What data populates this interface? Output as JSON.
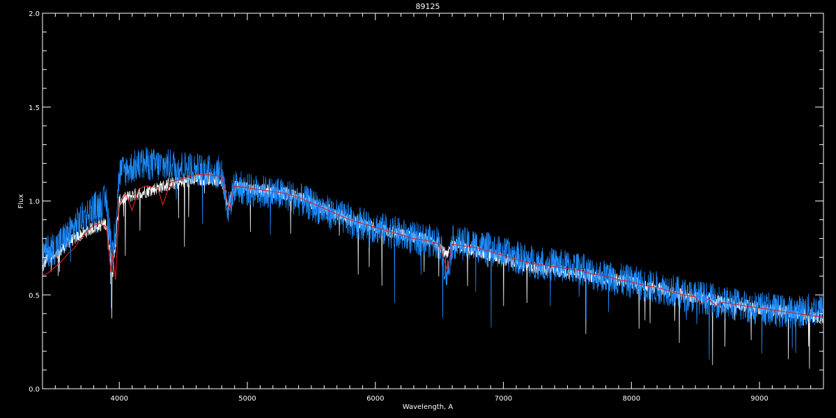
{
  "chart_data": {
    "type": "line",
    "title": "89125",
    "xlabel": "Wavelength, A",
    "ylabel": "Flux",
    "xlim": [
      3400,
      9500
    ],
    "ylim": [
      0.0,
      2.0
    ],
    "xticks": [
      4000,
      5000,
      6000,
      7000,
      8000,
      9000
    ],
    "xtick_labels": [
      "4000",
      "5000",
      "6000",
      "7000",
      "8000",
      "9000"
    ],
    "yticks": [
      0.0,
      0.5,
      1.0,
      1.5,
      2.0
    ],
    "ytick_labels": [
      "0.0",
      "0.5",
      "1.0",
      "1.5",
      "2.0"
    ],
    "grid": false,
    "background": "#000000",
    "series": [
      {
        "color": "#ffffff",
        "noise": 0.035,
        "points": [
          [
            3400,
            0.64
          ],
          [
            3450,
            0.72
          ],
          [
            3500,
            0.7
          ],
          [
            3600,
            0.78
          ],
          [
            3700,
            0.82
          ],
          [
            3800,
            0.86
          ],
          [
            3900,
            0.88
          ],
          [
            3950,
            0.62
          ],
          [
            4000,
            1.0
          ],
          [
            4100,
            1.03
          ],
          [
            4200,
            1.05
          ],
          [
            4300,
            1.07
          ],
          [
            4400,
            1.09
          ],
          [
            4500,
            1.1
          ],
          [
            4600,
            1.11
          ],
          [
            4700,
            1.12
          ],
          [
            4800,
            1.11
          ],
          [
            4850,
            0.98
          ],
          [
            4900,
            1.08
          ],
          [
            5000,
            1.07
          ],
          [
            5100,
            1.06
          ],
          [
            5200,
            1.05
          ],
          [
            5300,
            1.04
          ],
          [
            5400,
            1.02
          ],
          [
            5500,
            0.99
          ],
          [
            5600,
            0.96
          ],
          [
            5700,
            0.93
          ],
          [
            5800,
            0.9
          ],
          [
            5900,
            0.88
          ],
          [
            6000,
            0.86
          ],
          [
            6100,
            0.84
          ],
          [
            6200,
            0.82
          ],
          [
            6300,
            0.81
          ],
          [
            6400,
            0.79
          ],
          [
            6500,
            0.77
          ],
          [
            6560,
            0.7
          ],
          [
            6600,
            0.77
          ],
          [
            6700,
            0.75
          ],
          [
            6800,
            0.73
          ],
          [
            6900,
            0.71
          ],
          [
            7000,
            0.69
          ],
          [
            7100,
            0.67
          ],
          [
            7200,
            0.65
          ],
          [
            7300,
            0.64
          ],
          [
            7400,
            0.63
          ],
          [
            7500,
            0.62
          ],
          [
            7600,
            0.61
          ],
          [
            7700,
            0.6
          ],
          [
            7800,
            0.59
          ],
          [
            7900,
            0.58
          ],
          [
            8000,
            0.57
          ],
          [
            8100,
            0.55
          ],
          [
            8200,
            0.54
          ],
          [
            8300,
            0.52
          ],
          [
            8400,
            0.5
          ],
          [
            8500,
            0.49
          ],
          [
            8600,
            0.48
          ],
          [
            8700,
            0.46
          ],
          [
            8800,
            0.45
          ],
          [
            8900,
            0.44
          ],
          [
            9000,
            0.43
          ],
          [
            9100,
            0.42
          ],
          [
            9200,
            0.41
          ],
          [
            9300,
            0.4
          ],
          [
            9400,
            0.39
          ],
          [
            9500,
            0.38
          ]
        ]
      },
      {
        "color": "#1e8cff",
        "noise": 0.09,
        "points": [
          [
            3400,
            0.7
          ],
          [
            3450,
            0.74
          ],
          [
            3500,
            0.75
          ],
          [
            3600,
            0.82
          ],
          [
            3700,
            0.9
          ],
          [
            3800,
            0.96
          ],
          [
            3900,
            1.0
          ],
          [
            3950,
            0.7
          ],
          [
            4000,
            1.15
          ],
          [
            4100,
            1.18
          ],
          [
            4200,
            1.2
          ],
          [
            4300,
            1.19
          ],
          [
            4400,
            1.19
          ],
          [
            4500,
            1.18
          ],
          [
            4600,
            1.17
          ],
          [
            4700,
            1.16
          ],
          [
            4800,
            1.15
          ],
          [
            4850,
            0.95
          ],
          [
            4900,
            1.08
          ],
          [
            5000,
            1.06
          ],
          [
            5100,
            1.05
          ],
          [
            5200,
            1.04
          ],
          [
            5300,
            1.03
          ],
          [
            5400,
            1.01
          ],
          [
            5500,
            0.98
          ],
          [
            5600,
            0.95
          ],
          [
            5700,
            0.92
          ],
          [
            5800,
            0.9
          ],
          [
            5900,
            0.88
          ],
          [
            6000,
            0.86
          ],
          [
            6100,
            0.84
          ],
          [
            6200,
            0.82
          ],
          [
            6300,
            0.8
          ],
          [
            6400,
            0.79
          ],
          [
            6500,
            0.78
          ],
          [
            6560,
            0.6
          ],
          [
            6600,
            0.78
          ],
          [
            6700,
            0.77
          ],
          [
            6800,
            0.76
          ],
          [
            6900,
            0.74
          ],
          [
            7000,
            0.72
          ],
          [
            7100,
            0.7
          ],
          [
            7200,
            0.68
          ],
          [
            7300,
            0.67
          ],
          [
            7400,
            0.66
          ],
          [
            7500,
            0.65
          ],
          [
            7600,
            0.64
          ],
          [
            7700,
            0.61
          ],
          [
            7800,
            0.6
          ],
          [
            7900,
            0.58
          ],
          [
            8000,
            0.57
          ],
          [
            8100,
            0.55
          ],
          [
            8200,
            0.54
          ],
          [
            8300,
            0.53
          ],
          [
            8400,
            0.5
          ],
          [
            8500,
            0.49
          ],
          [
            8600,
            0.48
          ],
          [
            8700,
            0.46
          ],
          [
            8800,
            0.45
          ],
          [
            8900,
            0.44
          ],
          [
            9000,
            0.43
          ],
          [
            9100,
            0.42
          ],
          [
            9200,
            0.41
          ],
          [
            9300,
            0.41
          ],
          [
            9400,
            0.42
          ],
          [
            9500,
            0.42
          ]
        ]
      },
      {
        "color": "#e02020",
        "noise": 0.0,
        "points": [
          [
            3400,
            0.6
          ],
          [
            3450,
            0.62
          ],
          [
            3500,
            0.65
          ],
          [
            3550,
            0.68
          ],
          [
            3600,
            0.72
          ],
          [
            3650,
            0.75
          ],
          [
            3700,
            0.8
          ],
          [
            3750,
            0.84
          ],
          [
            3800,
            0.87
          ],
          [
            3850,
            0.88
          ],
          [
            3900,
            0.86
          ],
          [
            3935,
            0.62
          ],
          [
            3950,
            0.72
          ],
          [
            3970,
            0.58
          ],
          [
            4000,
            0.98
          ],
          [
            4050,
            1.04
          ],
          [
            4100,
            0.95
          ],
          [
            4150,
            1.06
          ],
          [
            4200,
            1.08
          ],
          [
            4300,
            1.07
          ],
          [
            4340,
            0.98
          ],
          [
            4400,
            1.1
          ],
          [
            4500,
            1.12
          ],
          [
            4600,
            1.14
          ],
          [
            4700,
            1.14
          ],
          [
            4800,
            1.13
          ],
          [
            4861,
            0.95
          ],
          [
            4900,
            1.08
          ],
          [
            5000,
            1.07
          ],
          [
            5100,
            1.06
          ],
          [
            5200,
            1.05
          ],
          [
            5300,
            1.04
          ],
          [
            5400,
            1.02
          ],
          [
            5500,
            0.99
          ],
          [
            5600,
            0.96
          ],
          [
            5700,
            0.93
          ],
          [
            5800,
            0.9
          ],
          [
            5900,
            0.88
          ],
          [
            6000,
            0.86
          ],
          [
            6100,
            0.84
          ],
          [
            6200,
            0.82
          ],
          [
            6300,
            0.8
          ],
          [
            6400,
            0.79
          ],
          [
            6500,
            0.77
          ],
          [
            6563,
            0.63
          ],
          [
            6600,
            0.77
          ],
          [
            6700,
            0.76
          ],
          [
            6800,
            0.75
          ],
          [
            6900,
            0.73
          ],
          [
            7000,
            0.71
          ],
          [
            7100,
            0.69
          ],
          [
            7200,
            0.67
          ],
          [
            7300,
            0.66
          ],
          [
            7400,
            0.65
          ],
          [
            7500,
            0.64
          ],
          [
            7600,
            0.63
          ],
          [
            7700,
            0.61
          ],
          [
            7800,
            0.6
          ],
          [
            7900,
            0.58
          ],
          [
            8000,
            0.57
          ],
          [
            8100,
            0.55
          ],
          [
            8200,
            0.54
          ],
          [
            8300,
            0.52
          ],
          [
            8400,
            0.5
          ],
          [
            8500,
            0.49
          ],
          [
            8542,
            0.45
          ],
          [
            8600,
            0.48
          ],
          [
            8662,
            0.44
          ],
          [
            8700,
            0.46
          ],
          [
            8800,
            0.45
          ],
          [
            8900,
            0.44
          ],
          [
            9000,
            0.43
          ],
          [
            9100,
            0.42
          ],
          [
            9200,
            0.41
          ],
          [
            9300,
            0.4
          ],
          [
            9400,
            0.39
          ],
          [
            9500,
            0.38
          ]
        ]
      }
    ]
  }
}
